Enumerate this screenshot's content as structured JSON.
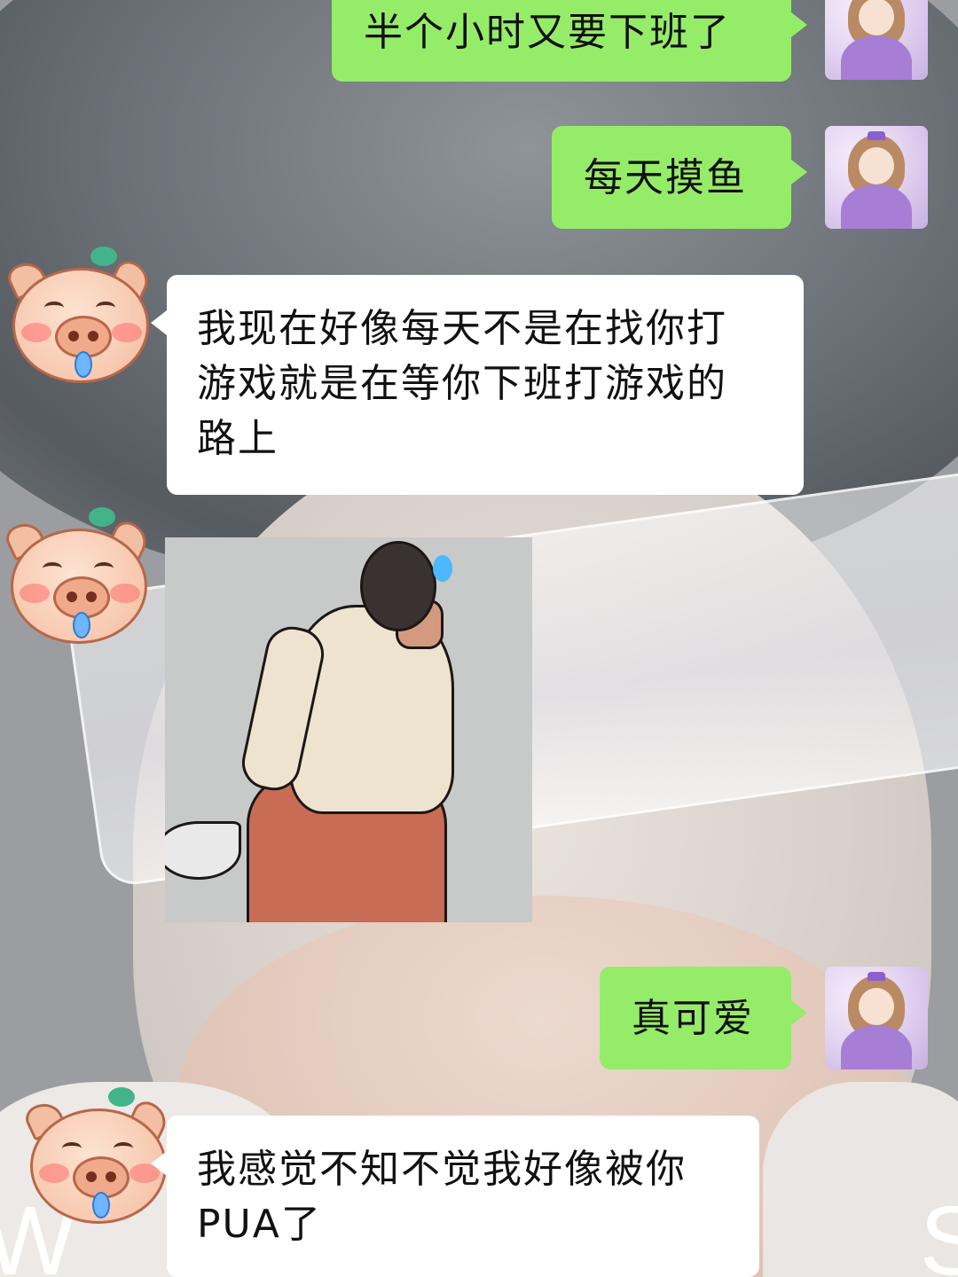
{
  "chat": {
    "messages": [
      {
        "side": "right",
        "text": "半个小时又要下班了"
      },
      {
        "side": "right",
        "text": "每天摸鱼"
      },
      {
        "side": "left",
        "text_lines": [
          "我现在好像每天不是在找你打",
          "游戏就是在等你下班打游戏的",
          "路上"
        ]
      },
      {
        "side": "left",
        "type": "sticker",
        "icon": "cartoon-man-scratching-sticker"
      },
      {
        "side": "right",
        "text": "真可爱"
      },
      {
        "side": "left",
        "text_lines": [
          "我感觉不知不觉我好像被你",
          "PUA了"
        ]
      }
    ]
  },
  "avatars": {
    "right_icon": "princess-avatar",
    "left_icon": "pig-emoji-avatar"
  },
  "background": {
    "watermark_left": "W",
    "watermark_right": "S"
  },
  "colors": {
    "my_bubble": "#95ec69",
    "their_bubble": "#ffffff"
  }
}
